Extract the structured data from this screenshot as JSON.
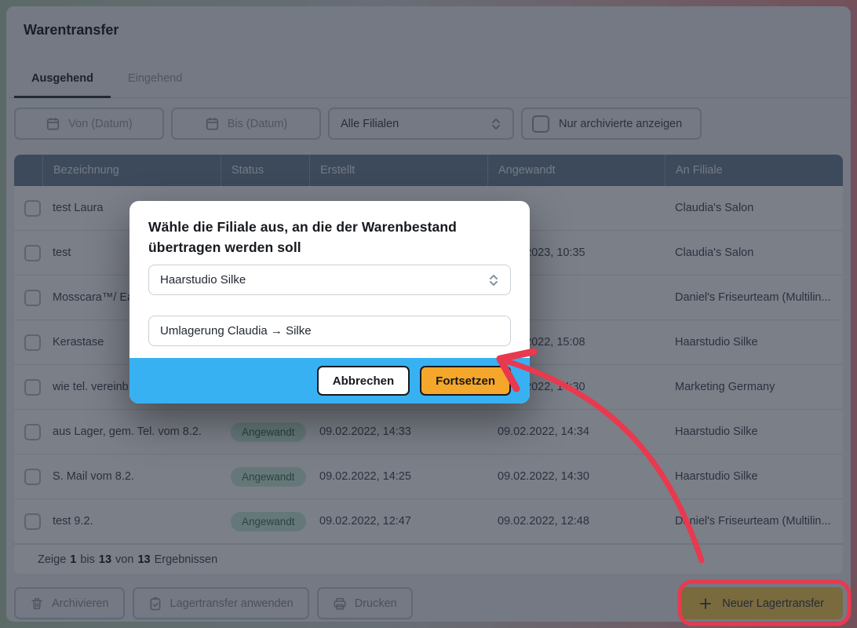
{
  "window": {
    "title": "Warentransfer"
  },
  "tabs": [
    {
      "label": "Ausgehend",
      "active": true
    },
    {
      "label": "Eingehend",
      "active": false
    }
  ],
  "filters": {
    "date_from_placeholder": "Von (Datum)",
    "date_to_placeholder": "Bis (Datum)",
    "branch_filter_value": "Alle Filialen",
    "archived_label": "Nur archivierte anzeigen",
    "archived_checked": false
  },
  "table": {
    "headers": [
      "Bezeichnung",
      "Status",
      "Erstellt",
      "Angewandt",
      "An Filiale"
    ],
    "rows": [
      {
        "name": "test Laura",
        "status": "",
        "erstellt": "",
        "angewandt": "",
        "angewandt_pad": false,
        "filiale": "Claudia's Salon"
      },
      {
        "name": "test",
        "status": "",
        "erstellt": "",
        "angewandt": "2023, 10:35",
        "angewandt_pad": true,
        "filiale": "Claudia's Salon"
      },
      {
        "name": "Mosscara™/ Ea",
        "status": "",
        "erstellt": "",
        "angewandt": "",
        "angewandt_pad": false,
        "filiale": "Daniel's Friseurteam (Multilin..."
      },
      {
        "name": "Kerastase",
        "status": "",
        "erstellt": "",
        "angewandt": "2022, 15:08",
        "angewandt_pad": true,
        "filiale": "Haarstudio Silke"
      },
      {
        "name": "wie tel. vereinb",
        "status": "",
        "erstellt": "",
        "angewandt": "2022, 14:30",
        "angewandt_pad": true,
        "filiale": "Marketing Germany"
      },
      {
        "name": "aus Lager, gem. Tel. vom 8.2.",
        "status": "Angewandt",
        "erstellt": "09.02.2022, 14:33",
        "angewandt": "09.02.2022, 14:34",
        "angewandt_pad": false,
        "filiale": "Haarstudio Silke"
      },
      {
        "name": "S. Mail vom 8.2.",
        "status": "Angewandt",
        "erstellt": "09.02.2022, 14:25",
        "angewandt": "09.02.2022, 14:30",
        "angewandt_pad": false,
        "filiale": "Haarstudio Silke"
      },
      {
        "name": "test 9.2.",
        "status": "Angewandt",
        "erstellt": "09.02.2022, 12:47",
        "angewandt": "09.02.2022, 12:48",
        "angewandt_pad": false,
        "filiale": "Daniel's Friseurteam (Multilin..."
      }
    ]
  },
  "pagination": {
    "parts": [
      {
        "text": "Zeige",
        "bold": false
      },
      {
        "text": "1",
        "bold": true
      },
      {
        "text": "bis",
        "bold": false
      },
      {
        "text": "13",
        "bold": true
      },
      {
        "text": "von",
        "bold": false
      },
      {
        "text": "13",
        "bold": true
      },
      {
        "text": "Ergebnissen",
        "bold": false
      }
    ]
  },
  "actions": {
    "archive": "Archivieren",
    "apply": "Lagertransfer anwenden",
    "print": "Drucken",
    "new_transfer": "Neuer Lagertransfer"
  },
  "modal": {
    "title": "Wähle die Filiale aus, an die der Warenbestand übertragen werden soll",
    "branch_select_value": "Haarstudio Silke",
    "name_input_value": "Umlagerung Claudia → Silke",
    "cancel": "Abbrechen",
    "continue": "Fortsetzen"
  },
  "colors": {
    "modal_footer_blue": "#38b1f2",
    "continue_amber": "#f5a72b",
    "annotation_red": "#e9394e",
    "status_badge_green": "#cdeddd",
    "table_header_slate": "#71879b"
  }
}
